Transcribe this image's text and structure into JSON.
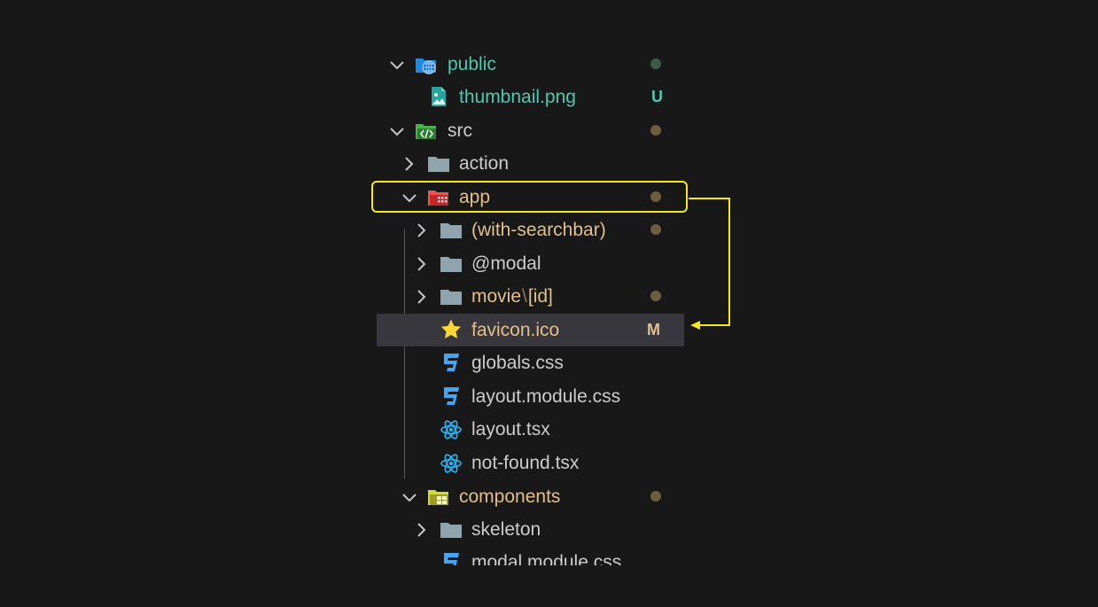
{
  "explorer": {
    "items": [
      {
        "name": "public",
        "kind": "folder-open",
        "color": "#4ec9b0",
        "status": "dot",
        "status_color": "#3e5a4a",
        "icon": "globe-folder-icon"
      },
      {
        "name": "thumbnail.png",
        "kind": "file",
        "color": "#4ec9b0",
        "status": "U",
        "status_color": "#4ec9b0",
        "icon": "image-file-icon"
      },
      {
        "name": "src",
        "kind": "folder-open",
        "color": "#cccccc",
        "status": "dot",
        "status_color": "#6b5d3e",
        "icon": "code-folder-icon"
      },
      {
        "name": "action",
        "kind": "folder-closed",
        "color": "#cccccc",
        "status": "",
        "icon": "folder-icon"
      },
      {
        "name": "app",
        "kind": "folder-open",
        "color": "#e2c08d",
        "status": "dot",
        "status_color": "#6b5d3e",
        "icon": "app-folder-icon"
      },
      {
        "name": "(with-searchbar)",
        "kind": "folder-closed",
        "color": "#e2c08d",
        "status": "dot",
        "status_color": "#6b5d3e",
        "icon": "folder-icon"
      },
      {
        "name": "@modal",
        "kind": "folder-closed",
        "color": "#cccccc",
        "status": "",
        "icon": "folder-icon"
      },
      {
        "name_a": "movie",
        "name_sep": "\\",
        "name_b": "[id]",
        "kind": "folder-closed",
        "color": "#e2c08d",
        "status": "dot",
        "status_color": "#6b5d3e",
        "icon": "folder-icon"
      },
      {
        "name": "favicon.ico",
        "kind": "file",
        "color": "#e2c08d",
        "status": "M",
        "status_color": "#e2c08d",
        "icon": "star-icon"
      },
      {
        "name": "globals.css",
        "kind": "file",
        "color": "#cccccc",
        "status": "",
        "icon": "css-file-icon"
      },
      {
        "name": "layout.module.css",
        "kind": "file",
        "color": "#cccccc",
        "status": "",
        "icon": "css-file-icon"
      },
      {
        "name": "layout.tsx",
        "kind": "file",
        "color": "#cccccc",
        "status": "",
        "icon": "react-file-icon"
      },
      {
        "name": "not-found.tsx",
        "kind": "file",
        "color": "#cccccc",
        "status": "",
        "icon": "react-file-icon"
      },
      {
        "name": "components",
        "kind": "folder-open",
        "color": "#e2c08d",
        "status": "dot",
        "status_color": "#6b5d3e",
        "icon": "components-folder-icon"
      },
      {
        "name": "skeleton",
        "kind": "folder-closed",
        "color": "#cccccc",
        "status": "",
        "icon": "folder-icon"
      },
      {
        "name": "modal.module.css",
        "kind": "file",
        "color": "#cccccc",
        "status": "",
        "icon": "css-file-icon"
      }
    ]
  },
  "annotation": {
    "highlight_color": "#f7e81c"
  }
}
